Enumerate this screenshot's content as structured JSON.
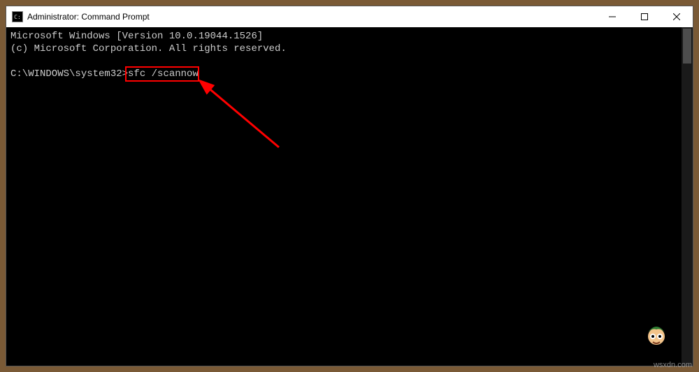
{
  "window": {
    "title": "Administrator: Command Prompt",
    "icon_label": "C:\\"
  },
  "terminal": {
    "line1": "Microsoft Windows [Version 10.0.19044.1526]",
    "line2": "(c) Microsoft Corporation. All rights reserved.",
    "blank": "",
    "prompt": "C:\\WINDOWS\\system32>",
    "command": "sfc /scannow"
  },
  "annotation": {
    "highlight_target": "command",
    "arrow_color": "#ff0000"
  },
  "watermark": "wsxdn.com"
}
